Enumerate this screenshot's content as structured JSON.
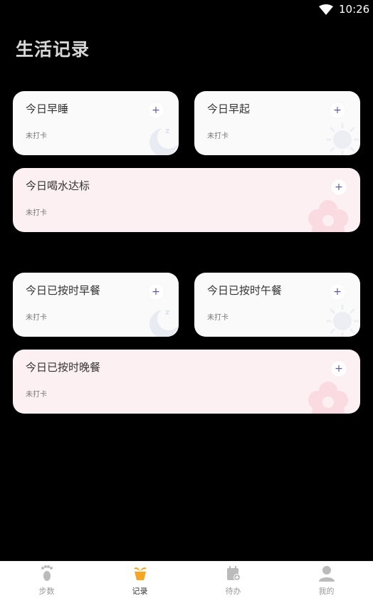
{
  "status_bar": {
    "time": "10:26"
  },
  "page": {
    "title": "生活记录"
  },
  "cards": [
    {
      "title": "今日早睡",
      "status": "未打卡",
      "add": "+",
      "icon": "moon-icon"
    },
    {
      "title": "今日早起",
      "status": "未打卡",
      "add": "+",
      "icon": "sun-icon"
    },
    {
      "title": "今日喝水达标",
      "status": "未打卡",
      "add": "+",
      "icon": "flower-icon"
    },
    {
      "title": "今日已按时早餐",
      "status": "未打卡",
      "add": "+",
      "icon": "moon-icon"
    },
    {
      "title": "今日已按时午餐",
      "status": "未打卡",
      "add": "+",
      "icon": "sun-icon"
    },
    {
      "title": "今日已按时晚餐",
      "status": "未打卡",
      "add": "+",
      "icon": "flower-icon"
    }
  ],
  "nav": [
    {
      "label": "步数",
      "icon": "footprint-icon"
    },
    {
      "label": "记录",
      "icon": "plant-pot-icon",
      "active": true
    },
    {
      "label": "待办",
      "icon": "calendar-add-icon"
    },
    {
      "label": "我的",
      "icon": "person-icon"
    }
  ],
  "colors": {
    "accent": "#f5a623",
    "plus": "#5b5a9e",
    "card_white": "#fafafa",
    "card_pink": "#fdf0f2"
  }
}
